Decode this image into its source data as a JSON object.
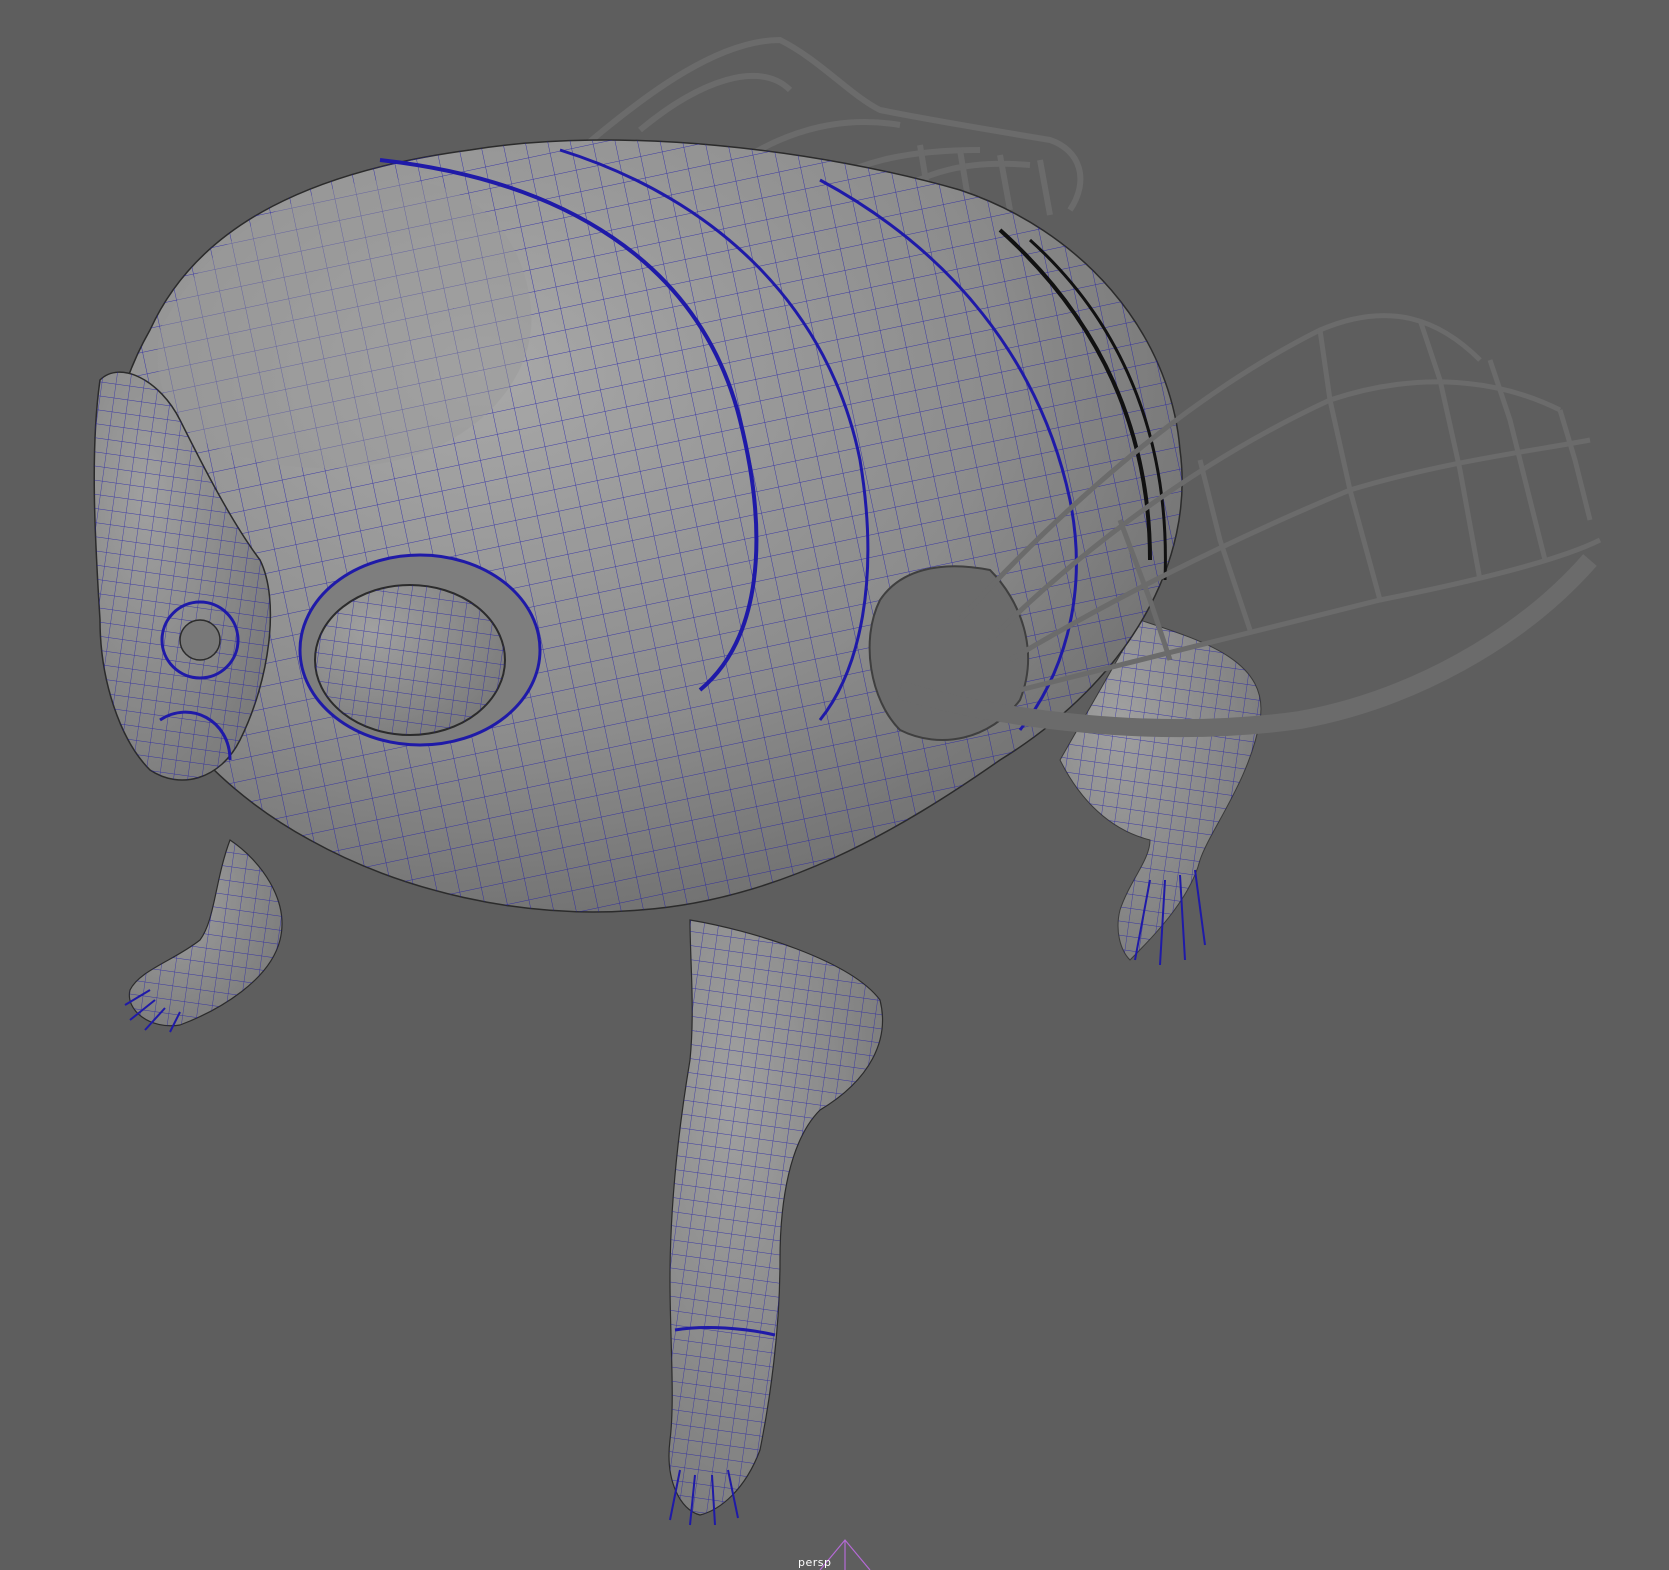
{
  "viewport": {
    "camera_name": "persp",
    "background_color": "#5e5e5e",
    "mesh_color": "#8d8d8d",
    "wireframe_color": "#1f1aa8",
    "wing_color": "#6b6b6b"
  },
  "scene": {
    "object": "creature-mesh",
    "display_mode": "wireframe-on-shaded"
  }
}
